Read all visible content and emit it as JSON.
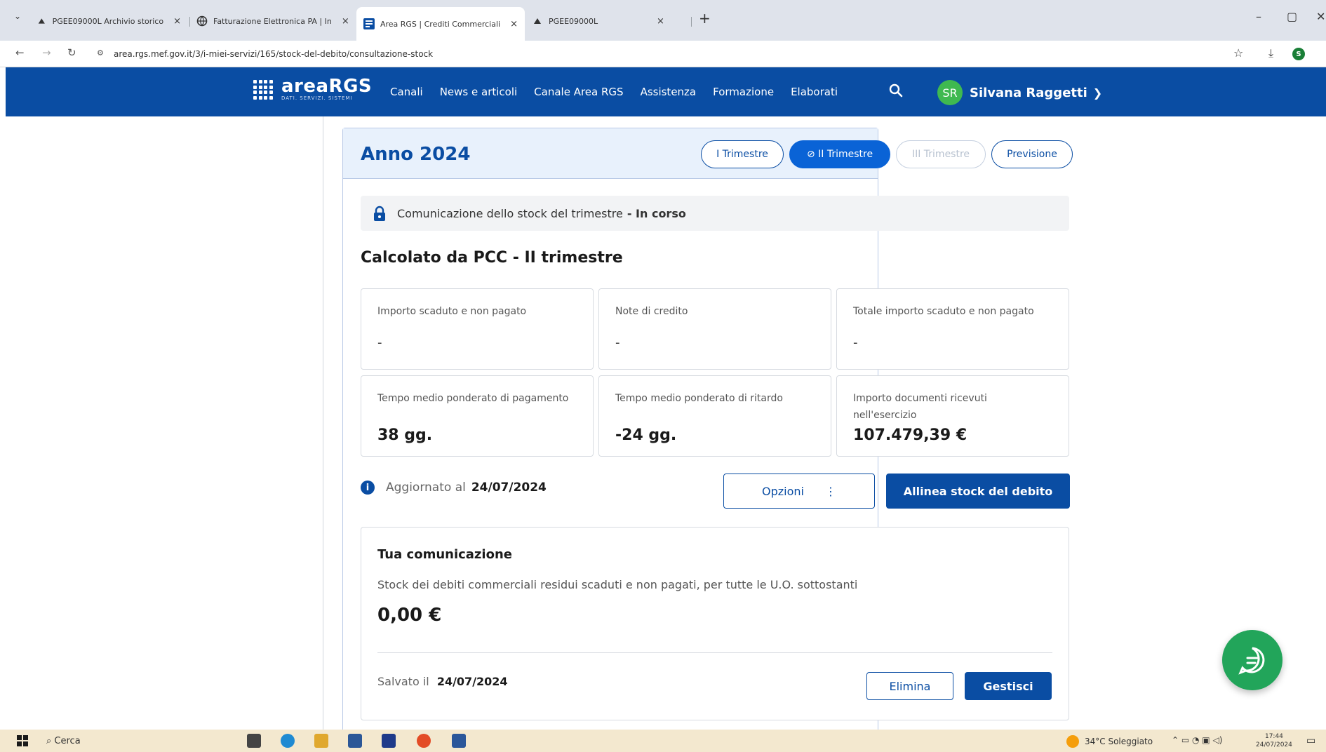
{
  "browser": {
    "tabs": [
      {
        "label": "PGEE09000L Archivio storico",
        "active": false
      },
      {
        "label": "Fatturazione Elettronica PA | In",
        "active": false
      },
      {
        "label": "Area RGS | Crediti Commerciali",
        "active": true
      },
      {
        "label": "PGEE09000L",
        "active": false
      }
    ],
    "new_tab": "+",
    "tab_list": "⌄",
    "url": "area.rgs.mef.gov.it/3/i-miei-servizi/165/stock-del-debito/consultazione-stock",
    "profile_initial": "S",
    "window_controls": {
      "minimize": "–",
      "maximize": "▢",
      "close": "✕"
    }
  },
  "site": {
    "logo_text": "areaRGS",
    "logo_sub": "DATI. SERVIZI. SISTEMI",
    "nav": [
      "Canali",
      "News e articoli",
      "Canale Area RGS",
      "Assistenza",
      "Formazione",
      "Elaborati"
    ],
    "user": {
      "initials": "SR",
      "name": "Silvana Raggetti"
    }
  },
  "card": {
    "year": "Anno 2024",
    "periods": [
      {
        "label": "I Trimestre",
        "state": "default"
      },
      {
        "label": "⊘ II Trimestre",
        "state": "selected"
      },
      {
        "label": "III Trimestre",
        "state": "disabled"
      },
      {
        "label": "Previsione",
        "state": "default"
      }
    ],
    "status_text": "Comunicazione dello stock del trimestre",
    "status_value": "- In corso",
    "section_title": "Calcolato da PCC - II trimestre",
    "metrics": [
      {
        "label": "Importo scaduto e non pagato",
        "value": "-"
      },
      {
        "label": "Note di credito",
        "value": "-"
      },
      {
        "label": "Totale importo scaduto e non pagato",
        "value": "-"
      },
      {
        "label": "Tempo medio ponderato di pagamento",
        "value": "38 gg."
      },
      {
        "label": "Tempo medio ponderato di ritardo",
        "value": "-24 gg."
      },
      {
        "label": "Importo documenti ricevuti nell'esercizio",
        "value": "107.479,39 €"
      }
    ],
    "updated_label": "Aggiornato al",
    "updated_date": "24/07/2024",
    "options_label": "Opzioni",
    "options_dots": "⋮",
    "align_label": "Allinea stock del debito",
    "communication": {
      "title": "Tua comunicazione",
      "description": "Stock dei debiti commerciali residui scaduti e non pagati, per tutte le U.O. sottostanti",
      "value": "0,00 €",
      "saved_label": "Salvato il",
      "saved_date": "24/07/2024",
      "delete_label": "Elimina",
      "manage_label": "Gestisci"
    }
  },
  "taskbar": {
    "search": "Cerca",
    "weather": "34°C Soleggiato",
    "time": "17:44",
    "date": "24/07/2024"
  },
  "colors": {
    "primary": "#0a4da3",
    "selected": "#0a63d6",
    "fab": "#22a55a",
    "header_bg": "#0a4da3"
  }
}
